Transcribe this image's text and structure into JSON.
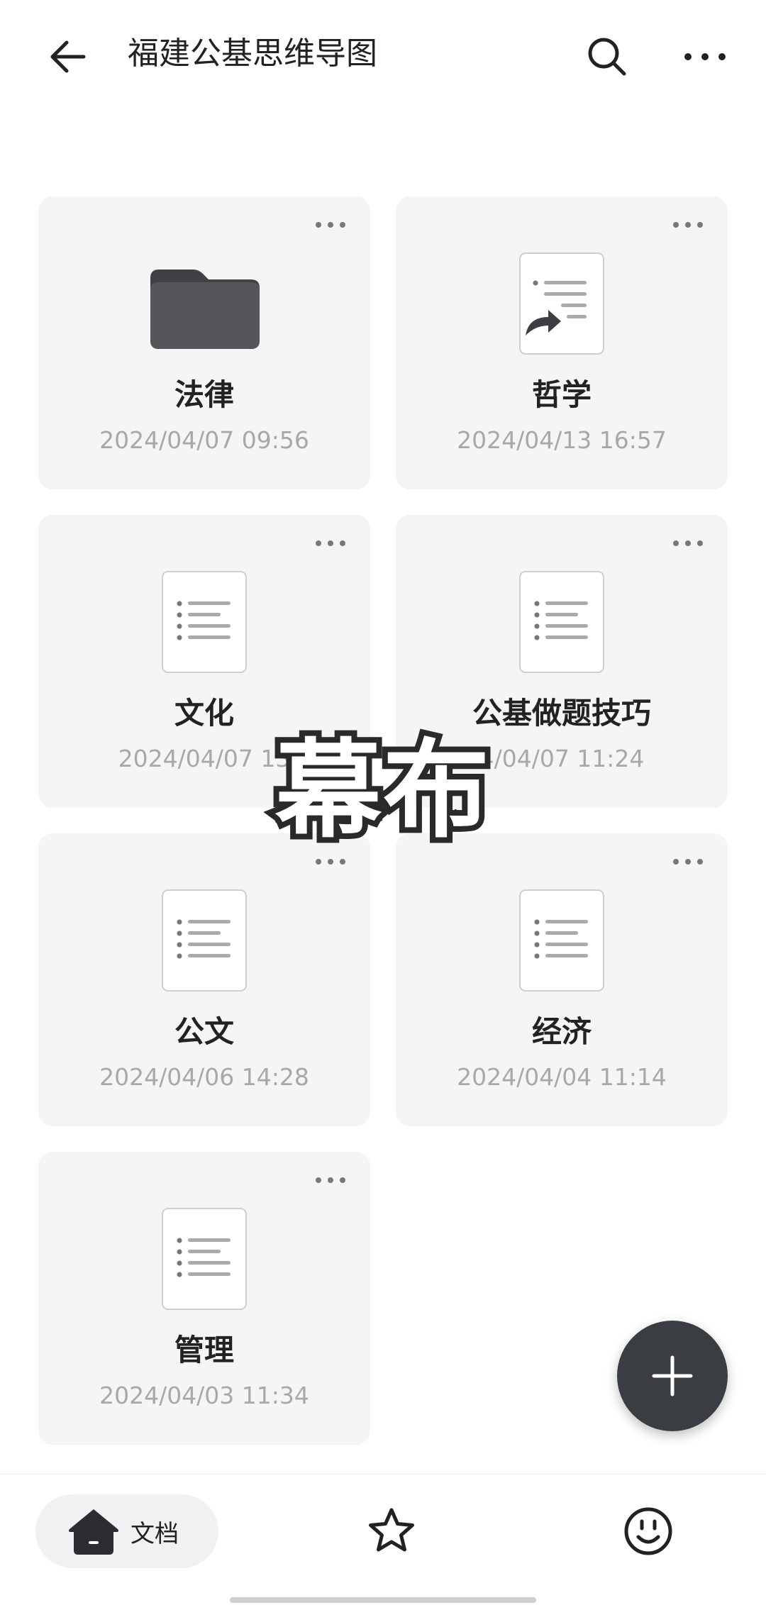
{
  "header": {
    "title": "福建公基思维导图",
    "back_icon": "arrow-left-icon",
    "search_icon": "search-icon",
    "more_icon": "more-horizontal-icon"
  },
  "items": [
    {
      "name": "法律",
      "date": "2024/04/07 09:56",
      "icon": "folder-icon"
    },
    {
      "name": "哲学",
      "date": "2024/04/13 16:57",
      "icon": "shared-document-icon"
    },
    {
      "name": "文化",
      "date": "2024/04/07 13",
      "icon": "document-list-icon"
    },
    {
      "name": "公基做题技巧",
      "date": "4/04/07 11:24",
      "icon": "document-list-icon"
    },
    {
      "name": "公文",
      "date": "2024/04/06 14:28",
      "icon": "document-list-icon"
    },
    {
      "name": "经济",
      "date": "2024/04/04 11:14",
      "icon": "document-list-icon"
    },
    {
      "name": "管理",
      "date": "2024/04/03 11:34",
      "icon": "document-list-icon"
    }
  ],
  "overlay": {
    "text": "幕布"
  },
  "fab": {
    "icon": "plus-icon"
  },
  "bottom_nav": {
    "docs_label": "文档",
    "docs_icon": "home-icon",
    "star_icon": "star-icon",
    "face_icon": "smiley-icon"
  },
  "colors": {
    "card_bg": "#f5f5f5",
    "date_text": "#a8a8a8",
    "fab_bg": "#3a3d41",
    "folder": "#545659"
  }
}
